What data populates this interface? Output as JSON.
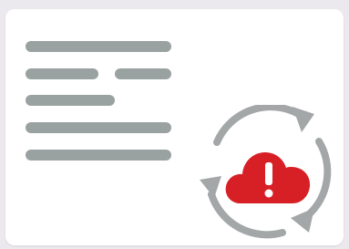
{
  "illustration": {
    "palette": {
      "background": "#ebe9ed",
      "card": "#ffffff",
      "placeholder_bars": "#9aa1a1",
      "sync_arrows": "#a3a7a8",
      "cloud": "#d71f26",
      "alert_mark": "#ffffff"
    },
    "icons": {
      "status": "cloud-alert-icon",
      "cycle": "sync-arrows-icon"
    }
  }
}
